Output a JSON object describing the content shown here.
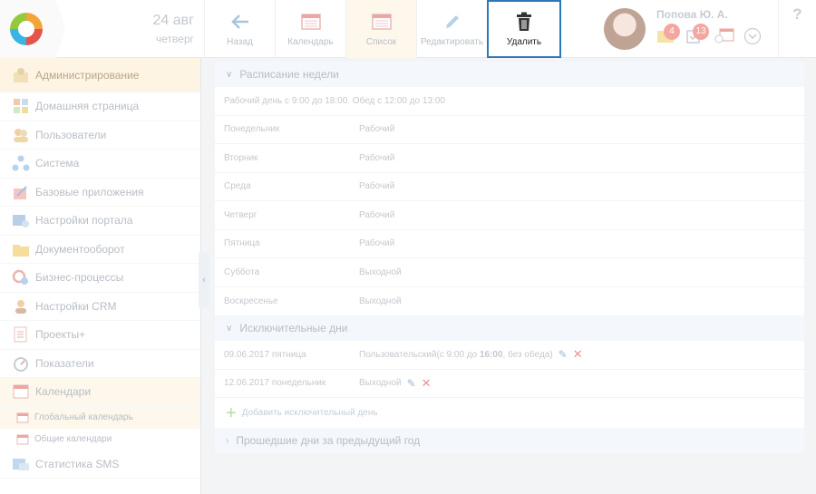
{
  "header": {
    "date_day": "24 авг",
    "date_weekday": "четверг",
    "toolbar": [
      {
        "id": "back",
        "label": "Назад",
        "icon": "arrow-left-icon"
      },
      {
        "id": "calendar",
        "label": "Календарь",
        "icon": "calendar-icon"
      },
      {
        "id": "list",
        "label": "Список",
        "icon": "list-calendar-icon"
      },
      {
        "id": "edit",
        "label": "Редактировать",
        "icon": "pencil-icon"
      },
      {
        "id": "delete",
        "label": "Удалить",
        "icon": "trash-icon"
      }
    ],
    "user_name": "Попова Ю. А.",
    "badge_messages": "4",
    "badge_tasks": "13",
    "help_label": "?"
  },
  "sidebar": {
    "items": [
      {
        "label": "Администрирование",
        "icon": "admin-icon"
      },
      {
        "label": "Домашняя страница",
        "icon": "home-grid-icon"
      },
      {
        "label": "Пользователи",
        "icon": "users-icon"
      },
      {
        "label": "Система",
        "icon": "system-icon"
      },
      {
        "label": "Базовые приложения",
        "icon": "apps-icon"
      },
      {
        "label": "Настройки портала",
        "icon": "portal-settings-icon"
      },
      {
        "label": "Документооборот",
        "icon": "folder-icon"
      },
      {
        "label": "Бизнес-процессы",
        "icon": "process-icon"
      },
      {
        "label": "Настройки CRM",
        "icon": "crm-icon"
      },
      {
        "label": "Проекты+",
        "icon": "projects-icon"
      },
      {
        "label": "Показатели",
        "icon": "gauge-icon"
      },
      {
        "label": "Календари",
        "icon": "calendar-icon"
      }
    ],
    "subitems": [
      {
        "label": "Глобальный календарь"
      },
      {
        "label": "Общие календари"
      }
    ],
    "last_item": {
      "label": "Статистика SMS",
      "icon": "sms-icon"
    }
  },
  "schedule": {
    "title": "Расписание недели",
    "summary": "Рабочий день с 9:00 до 18:00. Обед с 12:00 до 13:00",
    "days": [
      {
        "day": "Понедельник",
        "status": "Рабочий"
      },
      {
        "day": "Вторник",
        "status": "Рабочий"
      },
      {
        "day": "Среда",
        "status": "Рабочий"
      },
      {
        "day": "Четверг",
        "status": "Рабочий"
      },
      {
        "day": "Пятница",
        "status": "Рабочий"
      },
      {
        "day": "Суббота",
        "status": "Выходной"
      },
      {
        "day": "Воскресенье",
        "status": "Выходной"
      }
    ]
  },
  "exceptions": {
    "title": "Исключительные дни",
    "rows": [
      {
        "date": "09.06.2017 пятница",
        "value_pre": "Пользовательский(с 9:00 до ",
        "value_bold": "16:00",
        "value_post": ", без обеда)"
      },
      {
        "date": "12.06.2017 понедельник",
        "value_pre": "Выходной",
        "value_bold": "",
        "value_post": ""
      }
    ],
    "add_label": "Добавить исключительный день"
  },
  "past": {
    "title": "Прошедшие дни за предыдущий год"
  }
}
